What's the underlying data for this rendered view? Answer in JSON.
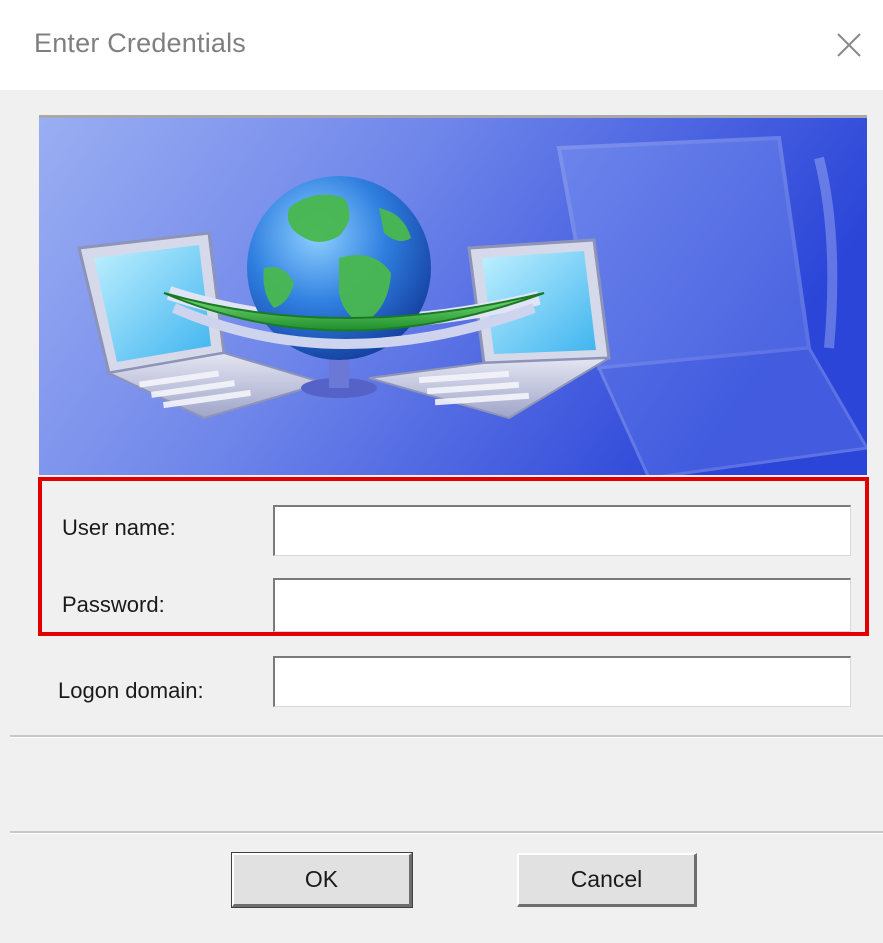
{
  "window": {
    "title": "Enter Credentials",
    "close_icon": "close-icon"
  },
  "banner": {
    "image": "network-globe-laptops-illustration",
    "colors": {
      "background_light": "#8fa6ee",
      "background_dark": "#2b45d8",
      "globe_water": "#2f7fe0",
      "globe_land": "#3fa84a",
      "ring": "#2fb83a"
    }
  },
  "form": {
    "username_label": "User name:",
    "username_value": "",
    "password_label": "Password:",
    "password_value": "",
    "domain_label": "Logon domain:",
    "domain_value": ""
  },
  "highlight": {
    "color": "#e00000",
    "target": "username-and-password-fields"
  },
  "buttons": {
    "ok_label": "OK",
    "cancel_label": "Cancel"
  }
}
